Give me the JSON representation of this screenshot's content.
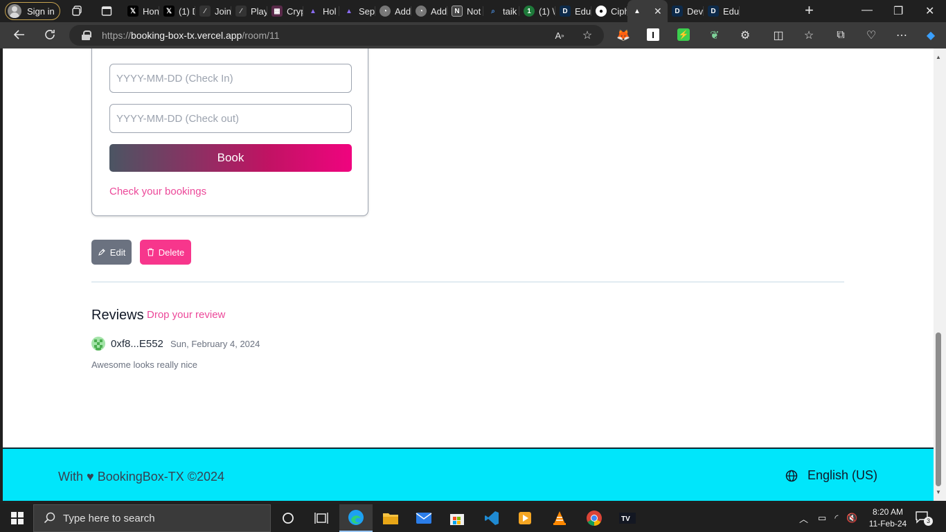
{
  "browser": {
    "sign_in_label": "Sign in",
    "tabs": [
      {
        "label": "Hon",
        "favicon": "x-logo"
      },
      {
        "label": "(1) D",
        "favicon": "x-logo"
      },
      {
        "label": "Join",
        "favicon": "slash-logo"
      },
      {
        "label": "Play",
        "favicon": "slash-logo"
      },
      {
        "label": "Cryp",
        "favicon": "grid-logo"
      },
      {
        "label": "Hol",
        "favicon": "triangle-logo"
      },
      {
        "label": "Sep",
        "favicon": "triangle-logo"
      },
      {
        "label": "Add",
        "favicon": "chart-logo"
      },
      {
        "label": "Add",
        "favicon": "chart-logo"
      },
      {
        "label": "Not",
        "favicon": "notion-logo"
      },
      {
        "label": "taik",
        "favicon": "search-logo"
      },
      {
        "label": "(1) \\",
        "favicon": "green-logo"
      },
      {
        "label": "Edu",
        "favicon": "d-logo"
      },
      {
        "label": "Ciph",
        "favicon": "github-logo"
      },
      {
        "label": "",
        "favicon": "vercel-logo",
        "active": true
      },
      {
        "label": "Dev",
        "favicon": "d-logo"
      },
      {
        "label": "Edu",
        "favicon": "d-logo"
      }
    ],
    "url_prefix": "https://",
    "url_host": "booking-box-tx.vercel.app",
    "url_path": "/room/11"
  },
  "booking": {
    "checkin_placeholder": "YYYY-MM-DD (Check In)",
    "checkout_placeholder": "YYYY-MM-DD (Check out)",
    "book_label": "Book",
    "check_bookings_label": "Check your bookings"
  },
  "actions": {
    "edit_label": "Edit",
    "delete_label": "Delete"
  },
  "reviews": {
    "title": "Reviews",
    "drop_label": "Drop your review",
    "items": [
      {
        "author": "0xf8...E552",
        "date": "Sun, February 4, 2024",
        "text": "Awesome looks really nice"
      }
    ]
  },
  "footer": {
    "copyright": "With ♥ BookingBox-TX ©2024",
    "language": "English (US)"
  },
  "taskbar": {
    "search_placeholder": "Type here to search",
    "time": "8:20 AM",
    "date": "11-Feb-24",
    "notification_count": "3"
  },
  "colors": {
    "accent_pink": "#ec4899",
    "footer_bg": "#00e6fb",
    "edit_bg": "#6b7280",
    "delete_bg": "#f7368c"
  }
}
